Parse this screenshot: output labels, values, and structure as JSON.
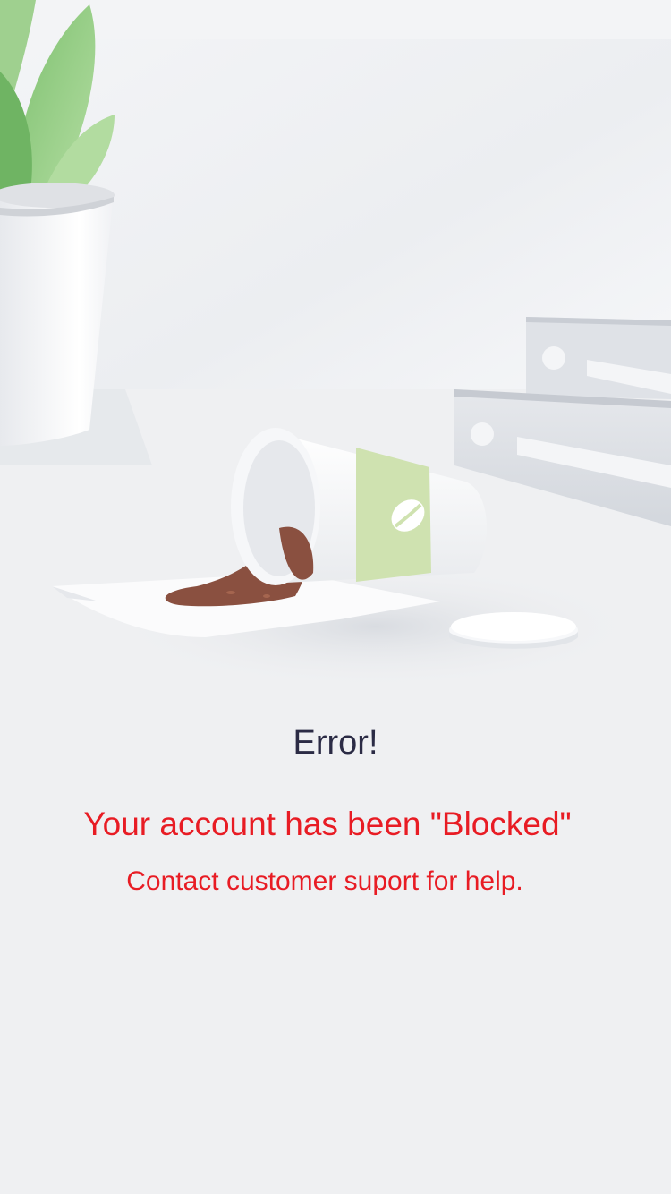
{
  "error_screen": {
    "title": "Error!",
    "status_message": "Your account has been \"Blocked\"",
    "help_message": "Contact customer suport for help."
  },
  "colors": {
    "background": "#eff0f2",
    "title_text": "#2b2b45",
    "alert_text": "#e81c24",
    "plant_green": "#8ccd7d",
    "cup_sleeve": "#cfe2b0",
    "coffee": "#8a5040"
  },
  "illustration": {
    "scene": "spilled-coffee-cup",
    "icons": [
      "plant-icon",
      "coffee-cup-icon",
      "coffee-bean-icon",
      "cup-lid-icon",
      "binders-icon",
      "paper-sheet-icon"
    ]
  }
}
